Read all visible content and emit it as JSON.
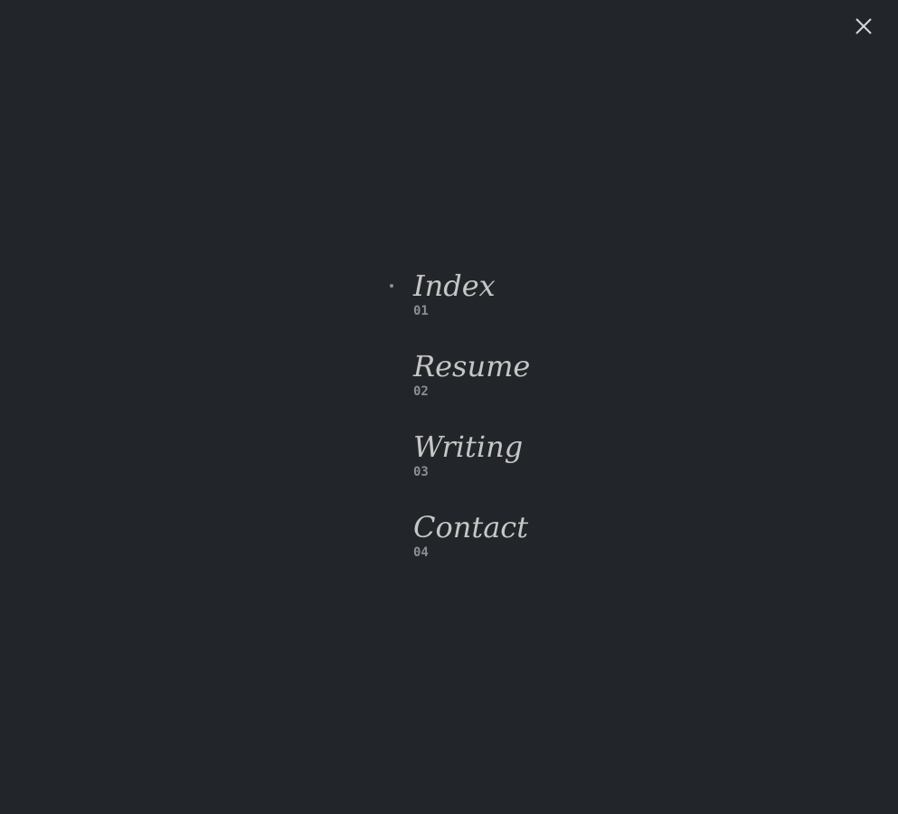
{
  "header": {
    "close_icon": "close-icon"
  },
  "nav": {
    "active_index": 0,
    "items": [
      {
        "label": "Index",
        "number": "01"
      },
      {
        "label": "Resume",
        "number": "02"
      },
      {
        "label": "Writing",
        "number": "03"
      },
      {
        "label": "Contact",
        "number": "04"
      }
    ]
  },
  "colors": {
    "background": "#222529",
    "label": "#c6c6c6",
    "number": "#8c8e92"
  }
}
